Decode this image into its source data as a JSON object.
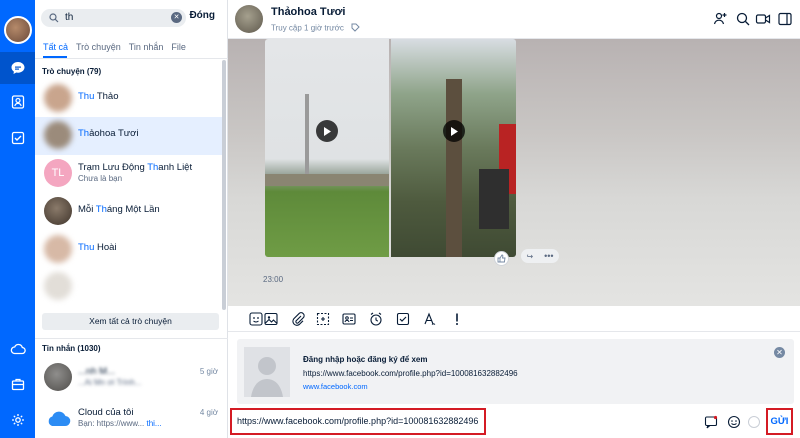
{
  "search": {
    "query": "th",
    "close_label": "Đóng"
  },
  "tabs": [
    "Tất cả",
    "Trò chuyện",
    "Tin nhắn",
    "File"
  ],
  "sections": {
    "conversations": "Trò chuyện (79)",
    "messages": "Tin nhắn (1030)"
  },
  "contacts": [
    {
      "name_hl": "Thu",
      "name_rest": " Thảo",
      "sub": ""
    },
    {
      "name_hl": "Th",
      "name_rest": "ảohoa Tươi",
      "sub": ""
    },
    {
      "name_pre": "Trạm Lưu Động ",
      "name_hl": "Th",
      "name_rest": "anh Liệt",
      "sub": "Chưa là bạn",
      "initials": "TL"
    },
    {
      "name_pre": "Mỗi ",
      "name_hl": "Th",
      "name_rest": "áng Một Lần",
      "sub": ""
    },
    {
      "name_hl": "Thu",
      "name_rest": " Hoài",
      "sub": ""
    }
  ],
  "see_all": "Xem tất cả trò chuyện",
  "messages": [
    {
      "name": "...nh M...",
      "time": "5 giờ",
      "sub": "...Ai Mn ơi Trình..."
    },
    {
      "name": "Cloud của tôi",
      "time": "4 giờ",
      "sub_pre": "Bạn: https://www... ",
      "sub_hl": "thi..."
    }
  ],
  "header": {
    "name": "Thảohoa Tươi",
    "status": "Truy cập 1 giờ trước"
  },
  "chat": {
    "time": "23:00"
  },
  "preview": {
    "title": "Đăng nhập hoặc đăng ký để xem",
    "url": "https://www.facebook.com/profile.php?id=100081632882496",
    "domain": "www.facebook.com"
  },
  "input": {
    "value": "https://www.facebook.com/profile.php?id=100081632882496"
  },
  "send_label": "GỬI",
  "colors": {
    "brand": "#0068ff",
    "highlight": "#d41b24"
  }
}
